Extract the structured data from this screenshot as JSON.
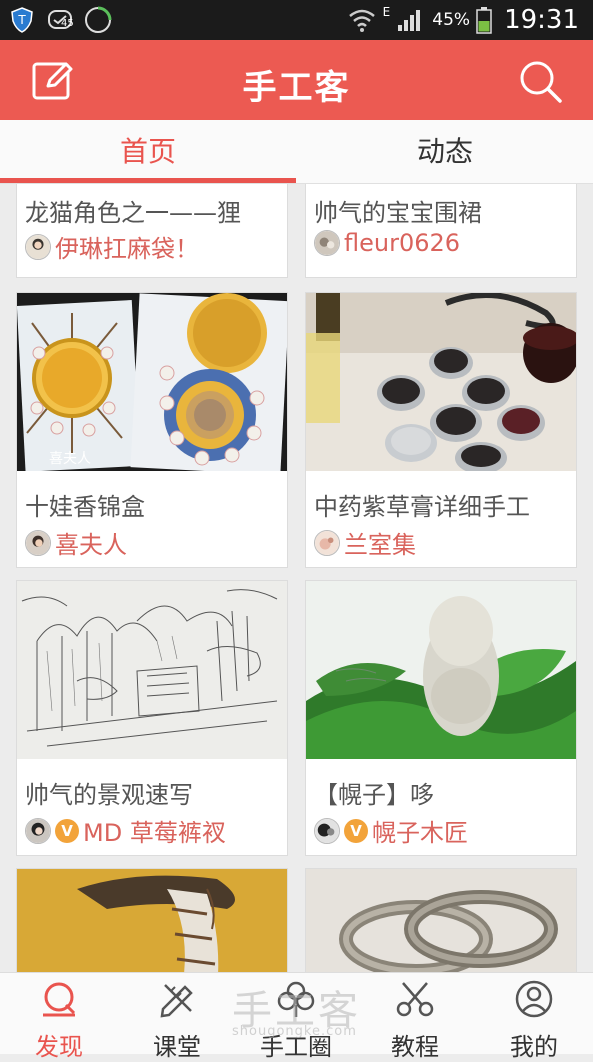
{
  "status_bar": {
    "network": "E",
    "battery": "45%",
    "time": "19:31",
    "badge": "45"
  },
  "app_bar": {
    "title": "手工客"
  },
  "tabs": [
    {
      "label": "首页"
    },
    {
      "label": "动态"
    }
  ],
  "cards": [
    {
      "title": "龙猫角色之一——狸",
      "author": "伊琳扛麻袋！"
    },
    {
      "title": "帅气的宝宝围裙",
      "author": "fleur0626"
    },
    {
      "title": "十娃香锦盒",
      "author": "喜夫人",
      "image_caption": "喜夫人"
    },
    {
      "title": "中药紫草膏详细手工",
      "author": "兰室集"
    },
    {
      "title": "帅气的景观速写",
      "author": "MD 草莓裤衩",
      "verified": "V"
    },
    {
      "title": "【幌子】哆",
      "author": "幌子木匠",
      "verified": "V"
    }
  ],
  "bottom_nav": [
    {
      "label": "发现"
    },
    {
      "label": "课堂"
    },
    {
      "label": "手工圈"
    },
    {
      "label": "教程"
    },
    {
      "label": "我的"
    }
  ],
  "watermark": {
    "text": "手工客",
    "sub": "shougongke.com"
  },
  "colors": {
    "accent": "#ec5a52",
    "author": "#d9635c",
    "badge": "#f2a33a"
  }
}
